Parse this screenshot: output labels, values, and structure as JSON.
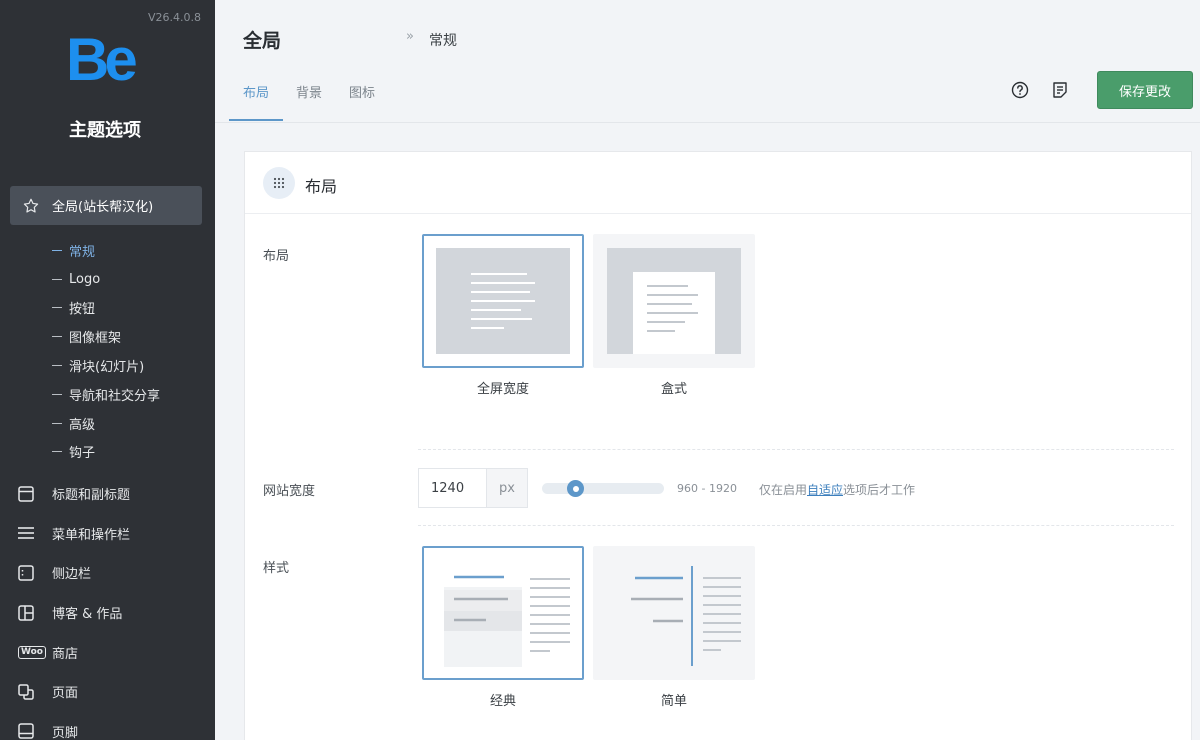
{
  "app": {
    "version": "V26.4.0.8",
    "logo_text": "Be",
    "title": "主题选项"
  },
  "sidebar": {
    "active_item": {
      "label": "全局(站长帮汉化)",
      "icon": "star-icon"
    },
    "subitems": [
      {
        "label": "常规",
        "active": true
      },
      {
        "label": "Logo"
      },
      {
        "label": "按钮"
      },
      {
        "label": "图像框架"
      },
      {
        "label": "滑块(幻灯片)"
      },
      {
        "label": "导航和社交分享"
      },
      {
        "label": "高级"
      },
      {
        "label": "钩子"
      }
    ],
    "items": [
      {
        "label": "标题和副标题",
        "icon": "header-icon"
      },
      {
        "label": "菜单和操作栏",
        "icon": "menu-icon"
      },
      {
        "label": "侧边栏",
        "icon": "sidebar-icon"
      },
      {
        "label": "博客 & 作品",
        "icon": "blog-icon"
      },
      {
        "label": "商店",
        "icon": "woo-icon",
        "icon_text": "Woo"
      },
      {
        "label": "页面",
        "icon": "pages-icon"
      },
      {
        "label": "页脚",
        "icon": "footer-icon"
      }
    ]
  },
  "header": {
    "title": "全局",
    "separator": "»",
    "subtitle": "常规",
    "tabs": [
      {
        "label": "布局",
        "active": true
      },
      {
        "label": "背景"
      },
      {
        "label": "图标"
      }
    ],
    "save_label": "保存更改"
  },
  "section": {
    "title": "布局",
    "layout": {
      "label": "布局",
      "options": [
        {
          "label": "全屏宽度",
          "selected": true
        },
        {
          "label": "盒式"
        }
      ]
    },
    "site_width": {
      "label": "网站宽度",
      "value": "1240",
      "unit": "px",
      "range": "960 - 1920",
      "slider_fraction": 0.29,
      "hint_before": "仅在启用",
      "hint_link": "自适应",
      "hint_after": "选项后才工作"
    },
    "style": {
      "label": "样式",
      "options": [
        {
          "label": "经典",
          "selected": true
        },
        {
          "label": "简单"
        }
      ]
    }
  },
  "colors": {
    "sidebar_bg": "#2e3136",
    "accent": "#5d97c9",
    "save_button": "#4a9d6b",
    "logo": "#1d8fef"
  }
}
